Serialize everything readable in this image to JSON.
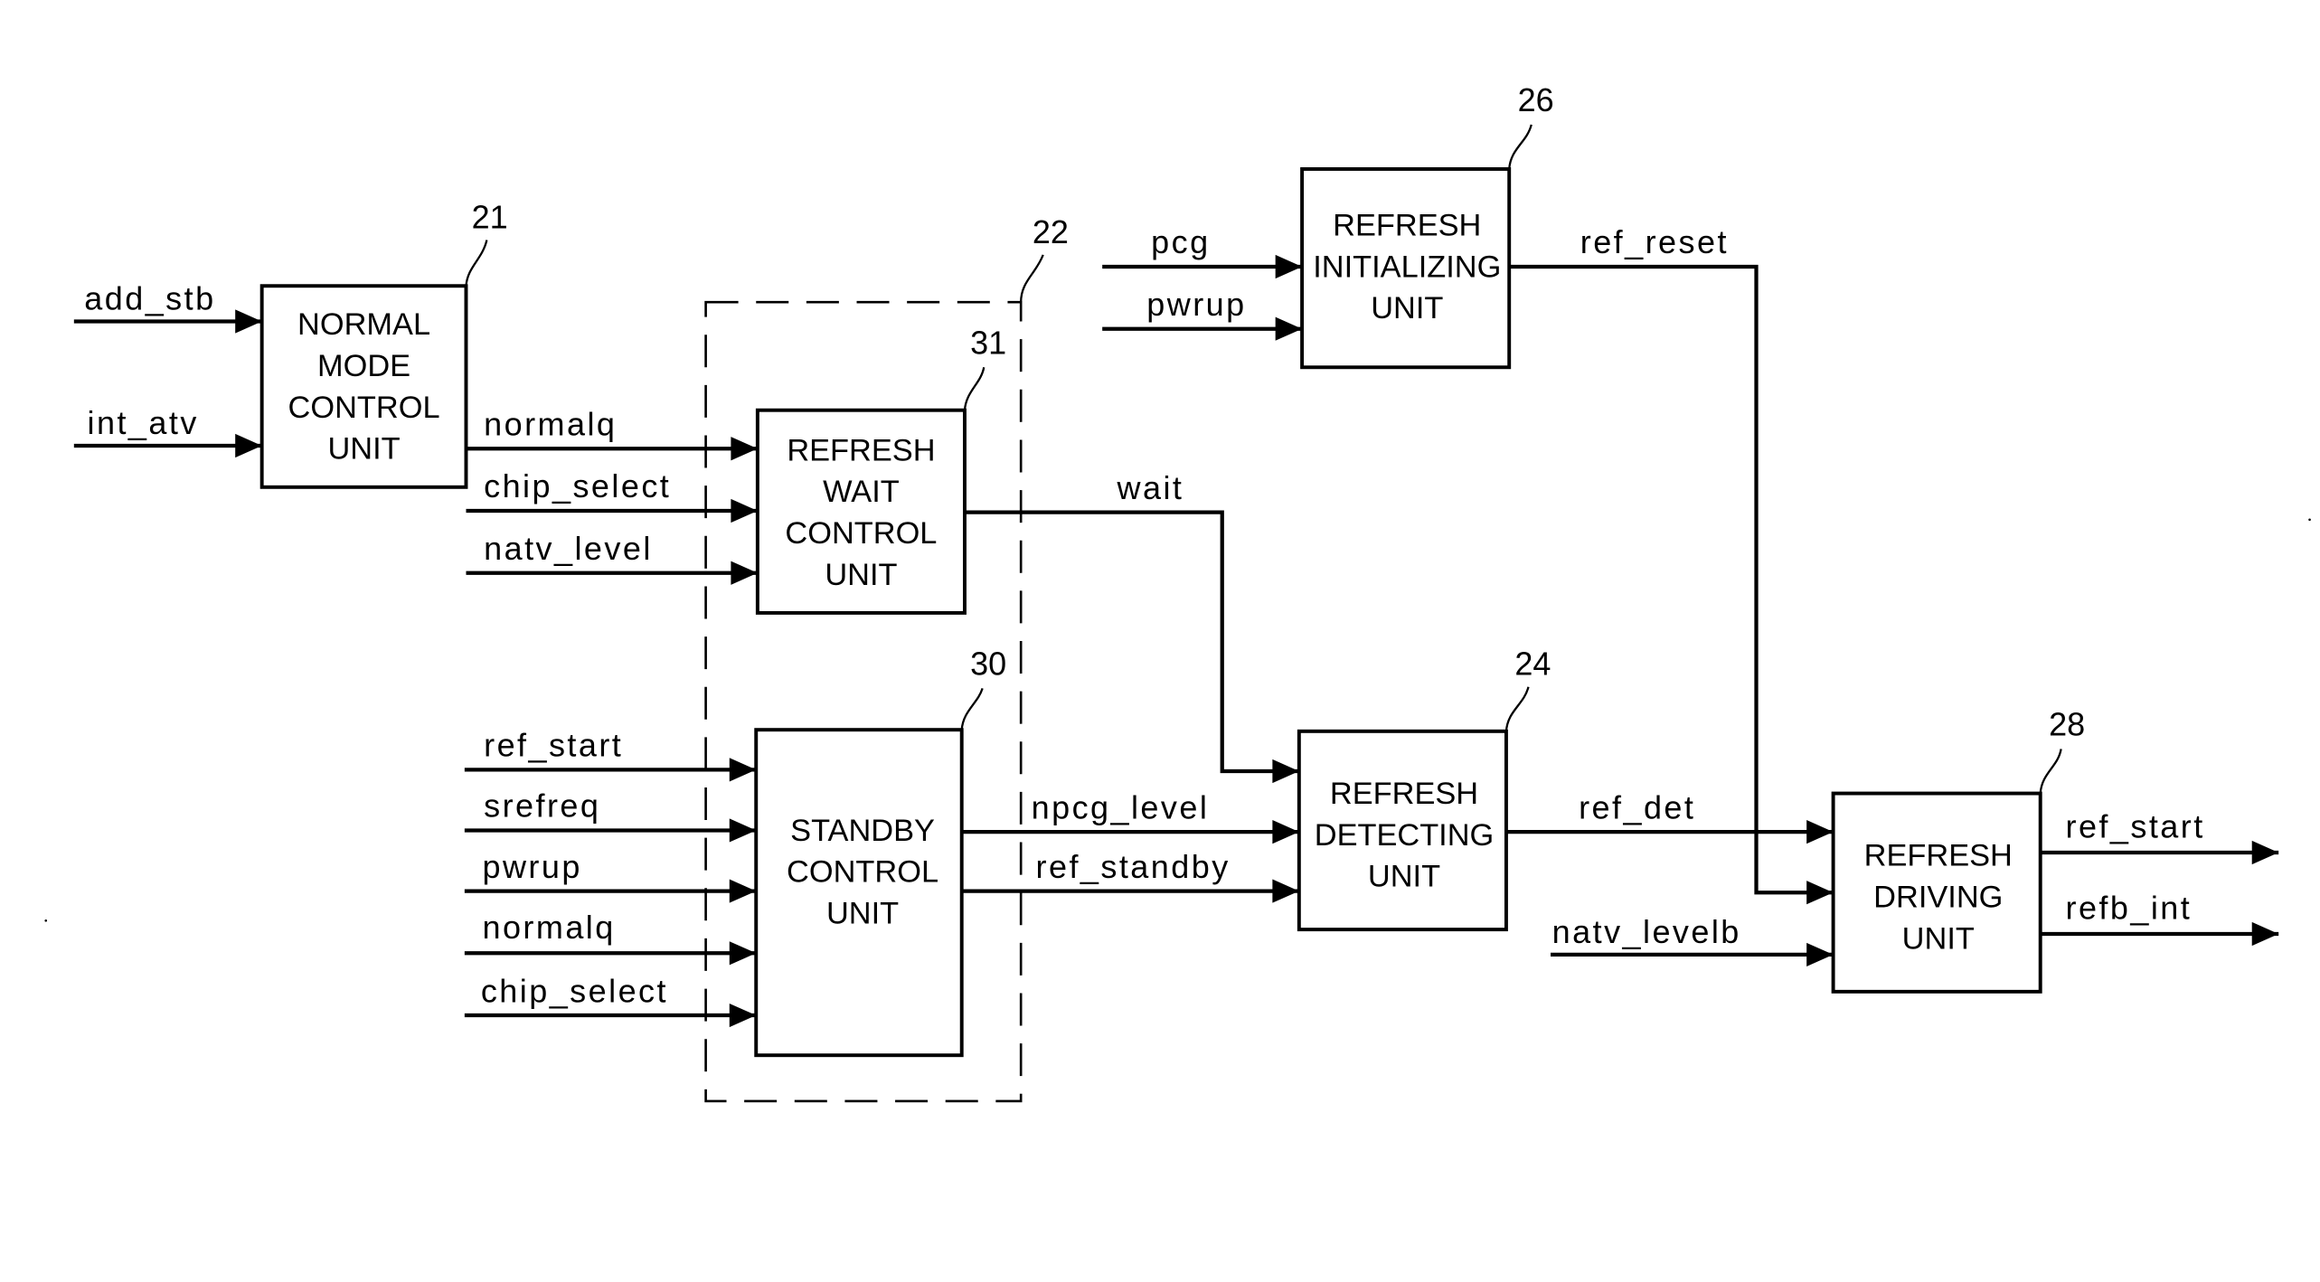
{
  "blocks": {
    "normal_mode": {
      "ref": "21",
      "lines": [
        "NORMAL",
        "MODE",
        "CONTROL",
        "UNIT"
      ]
    },
    "refresh_wait": {
      "ref": "31",
      "lines": [
        "REFRESH",
        "WAIT",
        "CONTROL",
        "UNIT"
      ]
    },
    "standby": {
      "ref": "30",
      "lines": [
        "STANDBY",
        "CONTROL",
        "UNIT"
      ]
    },
    "refresh_init": {
      "ref": "26",
      "lines": [
        "REFRESH",
        "INITIALIZING",
        "UNIT"
      ]
    },
    "refresh_detect": {
      "ref": "24",
      "lines": [
        "REFRESH",
        "DETECTING",
        "UNIT"
      ]
    },
    "refresh_drive": {
      "ref": "28",
      "lines": [
        "REFRESH",
        "DRIVING",
        "UNIT"
      ]
    },
    "group": {
      "ref": "22"
    }
  },
  "signals": {
    "add_stb": "add_stb",
    "int_atv": "int_atv",
    "normalq": "normalq",
    "chip_select": "chip_select",
    "natv_level": "natv_level",
    "wait": "wait",
    "ref_start_in": "ref_start",
    "srefreq": "srefreq",
    "pwrup_sb": "pwrup",
    "normalq_sb": "normalq",
    "chip_select_sb": "chip_select",
    "npcg_level": "npcg_level",
    "ref_standby": "ref_standby",
    "pcg": "pcg",
    "pwrup_init": "pwrup",
    "ref_reset": "ref_reset",
    "ref_det": "ref_det",
    "natv_levelb": "natv_levelb",
    "ref_start_out": "ref_start",
    "refb_int": "refb_int"
  }
}
